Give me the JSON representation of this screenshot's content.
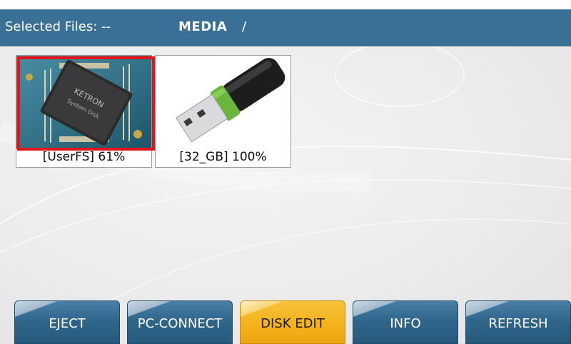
{
  "header": {
    "selected_files": "Selected Files: --",
    "path": "MEDIA",
    "separator": "/"
  },
  "files": [
    {
      "label": "[UserFS] 61%",
      "icon": "system-disk-chip-icon",
      "selected": true,
      "chip_text_1": "KETRON",
      "chip_text_2": "System Disk"
    },
    {
      "label": "[32_GB] 100%",
      "icon": "usb-drive-icon",
      "selected": false
    }
  ],
  "buttons": [
    {
      "label": "EJECT",
      "active": false
    },
    {
      "label": "PC-CONNECT",
      "active": false
    },
    {
      "label": "DISK EDIT",
      "active": true
    },
    {
      "label": "INFO",
      "active": false
    },
    {
      "label": "REFRESH",
      "active": false
    }
  ],
  "colors": {
    "header_bg": "#3a7096",
    "button_bg": "#2f6489",
    "button_active": "#f3b11b",
    "selection_border": "#e2161a"
  }
}
